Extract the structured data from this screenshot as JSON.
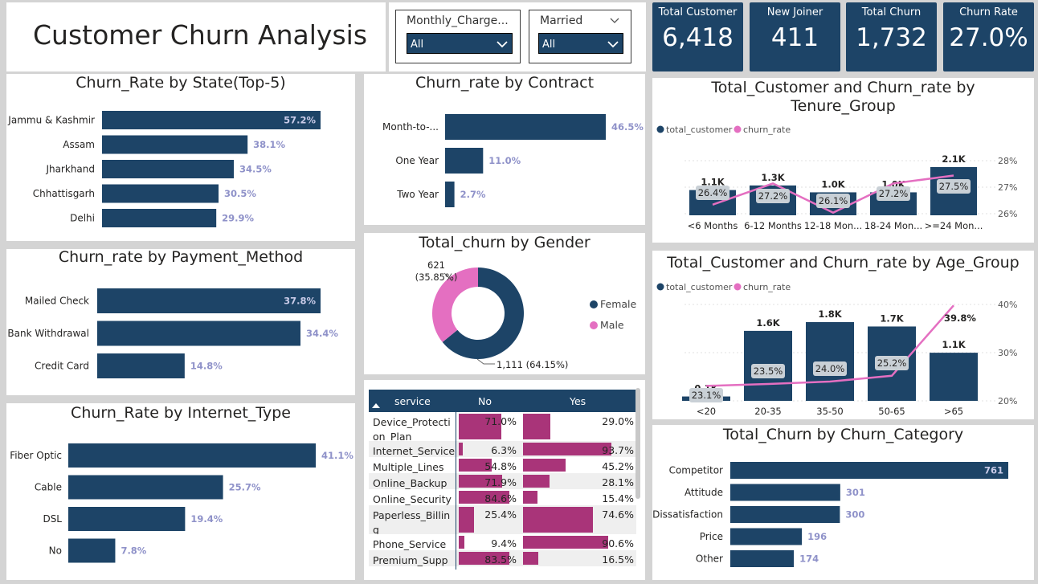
{
  "header": {
    "title": "Customer Churn Analysis"
  },
  "slicers": [
    {
      "label": "Monthly_Charge...",
      "value": "All"
    },
    {
      "label": "Married",
      "value": "All"
    }
  ],
  "kpis": [
    {
      "label": "Total Customer",
      "value": "6,418"
    },
    {
      "label": "New Joiner",
      "value": "411"
    },
    {
      "label": "Total Churn",
      "value": "1,732"
    },
    {
      "label": "Churn Rate",
      "value": "27.0%"
    }
  ],
  "colors": {
    "navy": "#1d4467",
    "pink": "#e46fc1",
    "magenta": "#a93479",
    "label_lilac": "#8f92c9"
  },
  "state_chart": {
    "title": "Churn_Rate by State(Top-5)",
    "chart_data": {
      "type": "bar",
      "categories": [
        "Jammu & Kashmir",
        "Assam",
        "Jharkhand",
        "Chhattisgarh",
        "Delhi"
      ],
      "values": [
        57.2,
        38.1,
        34.5,
        30.5,
        29.9
      ],
      "labels": [
        "57.2%",
        "38.1%",
        "34.5%",
        "30.5%",
        "29.9%"
      ]
    }
  },
  "contract_chart": {
    "title": "Churn_rate by Contract",
    "chart_data": {
      "type": "bar",
      "categories": [
        "Month-to-...",
        "One Year",
        "Two Year"
      ],
      "values": [
        46.5,
        11.0,
        2.7
      ],
      "labels": [
        "46.5%",
        "11.0%",
        "2.7%"
      ]
    }
  },
  "payment_chart": {
    "title": "Churn_rate by Payment_Method",
    "chart_data": {
      "type": "bar",
      "categories": [
        "Mailed Check",
        "Bank Withdrawal",
        "Credit Card"
      ],
      "values": [
        37.8,
        34.4,
        14.8
      ],
      "labels": [
        "37.8%",
        "34.4%",
        "14.8%"
      ]
    }
  },
  "gender_chart": {
    "title": "Total_churn by Gender",
    "chart_data": {
      "type": "pie",
      "categories": [
        "Female",
        "Male"
      ],
      "values": [
        1111,
        621
      ],
      "labels": [
        "1,111 (64.15%)",
        "621 (35.85%)"
      ]
    },
    "legend": [
      "Female",
      "Male"
    ]
  },
  "internet_chart": {
    "title": "Churn_Rate by Internet_Type",
    "chart_data": {
      "type": "bar",
      "categories": [
        "Fiber Optic",
        "Cable",
        "DSL",
        "No"
      ],
      "values": [
        41.1,
        25.7,
        19.4,
        7.8
      ],
      "labels": [
        "41.1%",
        "25.7%",
        "19.4%",
        "7.8%"
      ]
    }
  },
  "service_table": {
    "columns": [
      "service",
      "No",
      "Yes"
    ],
    "rows": [
      {
        "service": "Device_Protecti on_Plan",
        "no": 71.0,
        "yes": 29.0,
        "no_label": "71.0%",
        "yes_label": "29.0%"
      },
      {
        "service": "Internet_Service",
        "no": 6.3,
        "yes": 93.7,
        "no_label": "6.3%",
        "yes_label": "93.7%"
      },
      {
        "service": "Multiple_Lines",
        "no": 54.8,
        "yes": 45.2,
        "no_label": "54.8%",
        "yes_label": "45.2%"
      },
      {
        "service": "Online_Backup",
        "no": 71.9,
        "yes": 28.1,
        "no_label": "71.9%",
        "yes_label": "28.1%"
      },
      {
        "service": "Online_Security",
        "no": 84.6,
        "yes": 15.4,
        "no_label": "84.6%",
        "yes_label": "15.4%"
      },
      {
        "service": "Paperless_Billin g",
        "no": 25.4,
        "yes": 74.6,
        "no_label": "25.4%",
        "yes_label": "74.6%"
      },
      {
        "service": "Phone_Service",
        "no": 9.4,
        "yes": 90.6,
        "no_label": "9.4%",
        "yes_label": "90.6%"
      },
      {
        "service": "Premium_Supp",
        "no": 83.5,
        "yes": 16.5,
        "no_label": "83.5%",
        "yes_label": "16.5%"
      }
    ]
  },
  "tenure_chart": {
    "title": "Total_Customer and Churn_rate by Tenure_Group",
    "legend": [
      "total_customer",
      "churn_rate"
    ],
    "chart_data": {
      "type": "bar",
      "categories": [
        "<6 Months",
        "6-12 Months",
        "12-18 Mon...",
        "18-24 Mon...",
        ">=24 Mon..."
      ],
      "series": [
        {
          "name": "total_customer",
          "values": [
            1100,
            1300,
            1000,
            1000,
            2100
          ],
          "labels": [
            "1.1K",
            "1.3K",
            "1.0K",
            "1.0K",
            "2.1K"
          ]
        },
        {
          "name": "churn_rate",
          "values": [
            26.4,
            27.2,
            26.1,
            27.2,
            27.5
          ],
          "labels": [
            "26.4%",
            "27.2%",
            "26.1%",
            "27.2%",
            "27.5%"
          ]
        }
      ],
      "y2_ticks": [
        "28%",
        "27%",
        "26%"
      ]
    }
  },
  "age_chart": {
    "title": "Total_Customer and Churn_rate by Age_Group",
    "legend": [
      "total_customer",
      "churn_rate"
    ],
    "chart_data": {
      "type": "bar",
      "categories": [
        "<20",
        "20-35",
        "35-50",
        "50-65",
        ">65"
      ],
      "series": [
        {
          "name": "total_customer",
          "values": [
            100,
            1600,
            1800,
            1700,
            1100
          ],
          "labels": [
            "0.1K",
            "1.6K",
            "1.8K",
            "1.7K",
            "1.1K"
          ]
        },
        {
          "name": "churn_rate",
          "values": [
            23.1,
            23.5,
            24.0,
            25.2,
            39.8
          ],
          "labels": [
            "23.1%",
            "23.5%",
            "24.0%",
            "25.2%",
            "39.8%"
          ]
        }
      ],
      "y2_ticks": [
        "40%",
        "30%",
        "20%"
      ]
    }
  },
  "category_chart": {
    "title": "Total_Churn by Churn_Category",
    "chart_data": {
      "type": "bar",
      "categories": [
        "Competitor",
        "Attitude",
        "Dissatisfaction",
        "Price",
        "Other"
      ],
      "values": [
        761,
        301,
        300,
        196,
        174
      ],
      "labels": [
        "761",
        "301",
        "300",
        "196",
        "174"
      ]
    }
  }
}
